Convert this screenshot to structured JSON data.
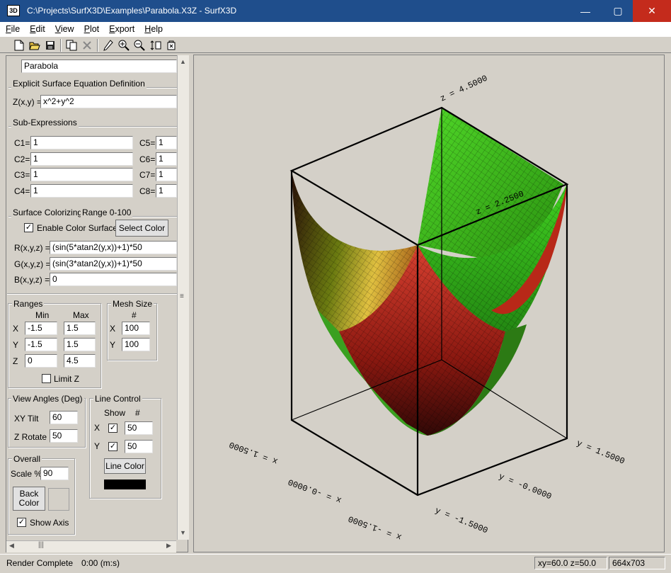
{
  "window": {
    "icon_label": "3D",
    "title": "C:\\Projects\\SurfX3D\\Examples\\Parabola.X3Z - SurfX3D",
    "minimize": "—",
    "maximize": "▢",
    "close": "✕"
  },
  "menu": [
    {
      "u": "F",
      "rest": "ile"
    },
    {
      "u": "E",
      "rest": "dit"
    },
    {
      "u": "V",
      "rest": "iew"
    },
    {
      "u": "P",
      "rest": "lot"
    },
    {
      "u": "E",
      "rest": "xport"
    },
    {
      "u": "H",
      "rest": "elp"
    }
  ],
  "toolbar": {
    "icons": [
      "new-file-icon",
      "open-folder-icon",
      "save-icon",
      "copy-icon",
      "delete-icon",
      "pencil-icon",
      "zoom-in-icon",
      "zoom-out-icon",
      "fit-icon",
      "reset-icon"
    ]
  },
  "panel": {
    "name_value": "Parabola",
    "explicit_title": "Explicit Surface Equation Definition",
    "z_label": "Z(x,y) =",
    "z_value": "x^2+y^2",
    "sub_title": "Sub-Expressions",
    "sub_left": [
      {
        "label": "C1=",
        "value": "1"
      },
      {
        "label": "C2=",
        "value": "1"
      },
      {
        "label": "C3=",
        "value": "1"
      },
      {
        "label": "C4=",
        "value": "1"
      }
    ],
    "sub_right": [
      {
        "label": "C5=",
        "value": "1"
      },
      {
        "label": "C6=",
        "value": "1"
      },
      {
        "label": "C7=",
        "value": "1"
      },
      {
        "label": "C8=",
        "value": "1"
      }
    ],
    "color_title": "Surface Colorizing",
    "color_range": "Range 0-100",
    "enable_color": "Enable Color Surface",
    "select_color": "Select Color",
    "r_label": "R(x,y,z) =",
    "r_value": "(sin(5*atan2(y,x))+1)*50",
    "g_label": "G(x,y,z) =",
    "g_value": "(sin(3*atan2(y,x))+1)*50",
    "b_label": "B(x,y,z) =",
    "b_value": "0",
    "ranges_title": "Ranges",
    "min_label": "Min",
    "max_label": "Max",
    "x_label": "X",
    "y_label": "Y",
    "z_axis_label": "Z",
    "x_min": "-1.5",
    "x_max": "1.5",
    "y_min": "-1.5",
    "y_max": "1.5",
    "z_min": "0",
    "z_max": "4.5",
    "limit_z": "Limit Z",
    "mesh_title": "Mesh Size",
    "mesh_hash": "#",
    "mesh_x": "100",
    "mesh_y": "100",
    "view_title": "View Angles (Deg)",
    "xy_tilt_label": "XY Tilt",
    "xy_tilt": "60",
    "z_rotate_label": "Z Rotate",
    "z_rotate": "50",
    "line_title": "Line Control",
    "show_label": "Show",
    "line_hash": "#",
    "line_x": "50",
    "line_y": "50",
    "line_color": "Line Color",
    "overall_title": "Overall",
    "scale_label": "Scale %",
    "scale_value": "90",
    "back_color": "Back Color",
    "show_axis": "Show Axis",
    "check_mark": "✓"
  },
  "plot": {
    "z_max_label": "z = 4.5000",
    "z_mid_label": "z = 2.2500",
    "x_min_label": "x = -1.5000",
    "x_mid_label": "x = -0.0000",
    "x_max_label": "x = 1.5000",
    "y_min_label": "y = -1.5000",
    "y_mid_label": "y = -0.0000",
    "y_max_label": "y = 1.5000"
  },
  "status": {
    "message": "Render Complete",
    "time": "0:00 (m:s)",
    "angles": "xy=60.0 z=50.0",
    "size": "664x703"
  },
  "colors": {
    "title_bar": "#1f4e8c",
    "close_button": "#c42b1c",
    "panel_bg": "#d4d0c8"
  }
}
